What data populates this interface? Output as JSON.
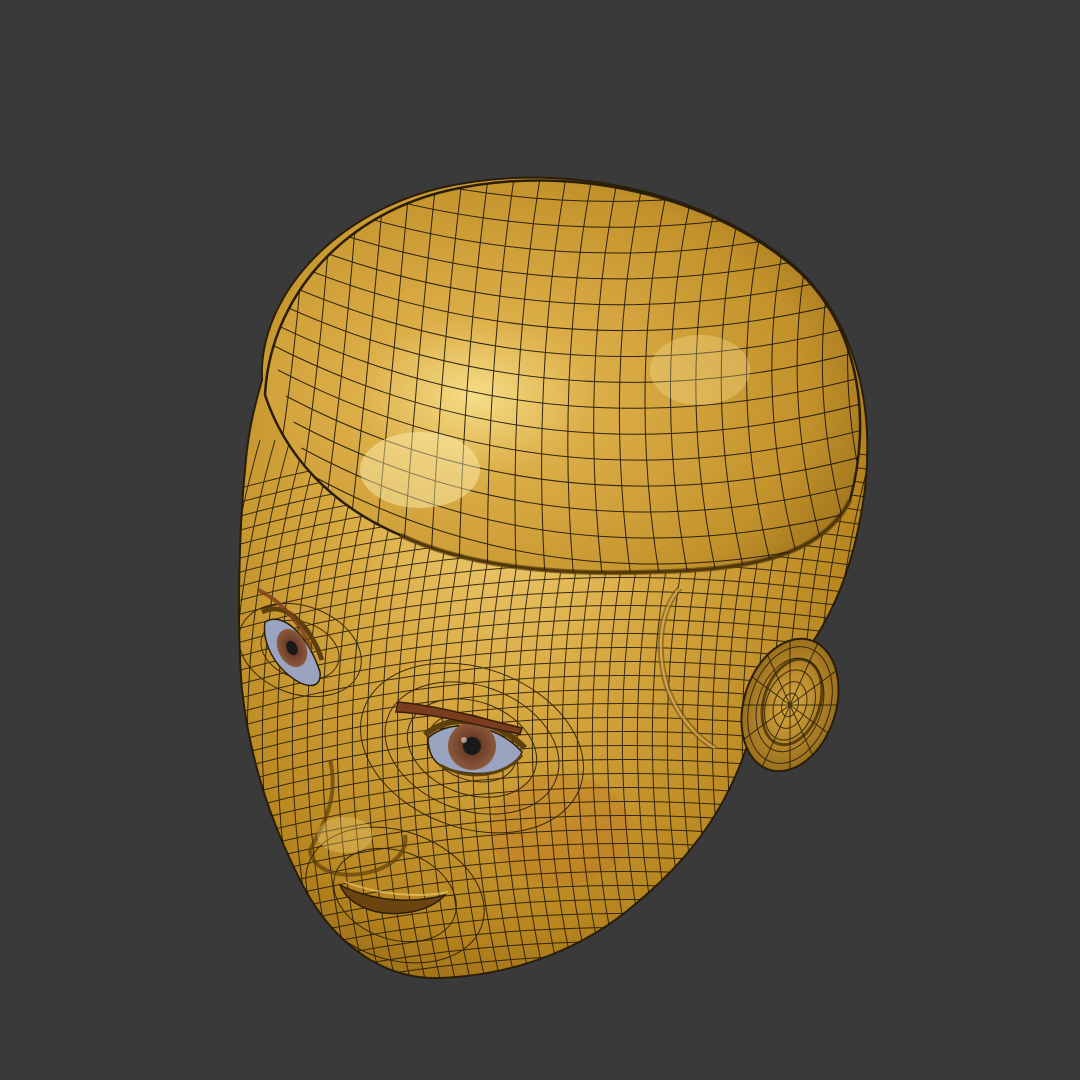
{
  "scene": {
    "subject": "wireframe-head-model",
    "colors": {
      "background": "#3a3a3a",
      "surface_base": "#c99a2e",
      "surface_light": "#f2d27a",
      "surface_shadow": "#7a5410",
      "wire": "#1c1407",
      "iris": "#6e3d2a",
      "pupil": "#1a1a1a",
      "eye_white": "#9aa4c0",
      "brow": "#7a3e1e"
    }
  }
}
